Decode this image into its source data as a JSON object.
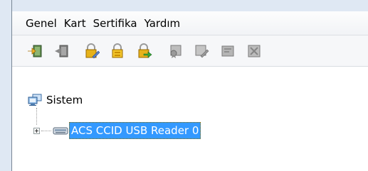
{
  "menu": {
    "items": [
      "Genel",
      "Kart",
      "Sertifika",
      "Yardım"
    ]
  },
  "toolbar": {
    "buttons": [
      {
        "icon": "connect-icon",
        "enabled": true
      },
      {
        "icon": "disconnect-icon",
        "enabled": false
      },
      {
        "icon": "lock-edit-icon",
        "enabled": true
      },
      {
        "icon": "lock-key-icon",
        "enabled": true
      },
      {
        "icon": "lock-arrow-icon",
        "enabled": true
      },
      {
        "icon": "certificate-read-icon",
        "enabled": false
      },
      {
        "icon": "certificate-edit-icon",
        "enabled": false
      },
      {
        "icon": "certificate-icon",
        "enabled": false
      },
      {
        "icon": "certificate-delete-icon",
        "enabled": false
      }
    ]
  },
  "tree": {
    "root_label": "Sistem",
    "child_label": "ACS CCID USB Reader 0"
  },
  "colors": {
    "selection": "#3399ff",
    "gold": "#e6b21a",
    "green": "#3aa63a"
  }
}
